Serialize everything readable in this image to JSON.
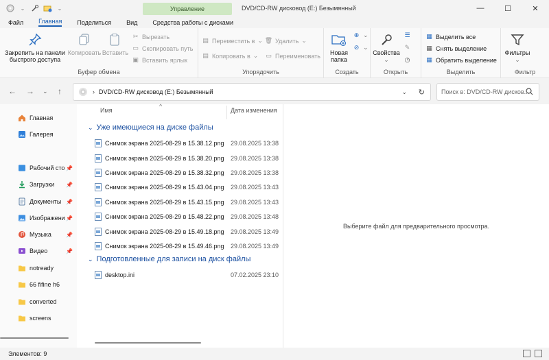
{
  "titlebar": {
    "context_tab": "Управление",
    "title": "DVD/CD-RW дисковод (E:) Безымянный"
  },
  "menu": [
    {
      "label": "Файл",
      "active": false
    },
    {
      "label": "Главная",
      "active": true
    },
    {
      "label": "Поделиться",
      "active": false
    },
    {
      "label": "Вид",
      "active": false
    },
    {
      "label": "Средства работы с дисками",
      "active": false
    }
  ],
  "ribbon": {
    "clipboard": {
      "pin_label": "Закрепить на панели быстрого доступа",
      "copy_label": "Копировать",
      "paste_label": "Вставить",
      "cut_label": "Вырезать",
      "copy_path_label": "Скопировать путь",
      "paste_shortcut_label": "Вставить ярлык",
      "group_label": "Буфер обмена"
    },
    "organize": {
      "move_label": "Переместить в",
      "copyto_label": "Копировать в",
      "delete_label": "Удалить",
      "rename_label": "Переименовать",
      "group_label": "Упорядочить"
    },
    "create": {
      "new_folder_label": "Новая папка",
      "group_label": "Создать"
    },
    "open": {
      "properties_label": "Свойства",
      "group_label": "Открыть"
    },
    "select": {
      "select_all_label": "Выделить все",
      "select_none_label": "Снять выделение",
      "invert_label": "Обратить выделение",
      "group_label": "Выделить"
    },
    "filter": {
      "filters_label": "Фильтры",
      "group_label": "Фильтр"
    }
  },
  "address": {
    "path": "DVD/CD-RW дисковод (E:) Безымянный",
    "search_placeholder": "Поиск в: DVD/CD-RW дисков..."
  },
  "sidebar": {
    "items": [
      {
        "label": "Главная",
        "icon": "home-icon",
        "pinned": false
      },
      {
        "label": "Галерея",
        "icon": "gallery-icon",
        "pinned": false
      },
      {
        "label": "Рабочий сто",
        "icon": "desktop-icon",
        "pinned": true
      },
      {
        "label": "Загрузки",
        "icon": "downloads-icon",
        "pinned": true
      },
      {
        "label": "Документы",
        "icon": "documents-icon",
        "pinned": true
      },
      {
        "label": "Изображени",
        "icon": "pictures-icon",
        "pinned": true
      },
      {
        "label": "Музыка",
        "icon": "music-icon",
        "pinned": true
      },
      {
        "label": "Видео",
        "icon": "video-icon",
        "pinned": true
      },
      {
        "label": "notready",
        "icon": "folder-icon",
        "pinned": false
      },
      {
        "label": "66 fifine h6",
        "icon": "folder-icon",
        "pinned": false
      },
      {
        "label": "converted",
        "icon": "folder-icon",
        "pinned": false
      },
      {
        "label": "screens",
        "icon": "folder-icon",
        "pinned": false
      }
    ]
  },
  "filelist": {
    "col_name": "Имя",
    "col_date": "Дата изменения",
    "groups": [
      {
        "title": "Уже имеющиеся на диске файлы",
        "files": [
          {
            "name": "Снимок экрана 2025-08-29 в 15.38.12.png",
            "date": "29.08.2025 13:38"
          },
          {
            "name": "Снимок экрана 2025-08-29 в 15.38.20.png",
            "date": "29.08.2025 13:38"
          },
          {
            "name": "Снимок экрана 2025-08-29 в 15.38.32.png",
            "date": "29.08.2025 13:38"
          },
          {
            "name": "Снимок экрана 2025-08-29 в 15.43.04.png",
            "date": "29.08.2025 13:43"
          },
          {
            "name": "Снимок экрана 2025-08-29 в 15.43.15.png",
            "date": "29.08.2025 13:43"
          },
          {
            "name": "Снимок экрана 2025-08-29 в 15.48.22.png",
            "date": "29.08.2025 13:48"
          },
          {
            "name": "Снимок экрана 2025-08-29 в 15.49.18.png",
            "date": "29.08.2025 13:49"
          },
          {
            "name": "Снимок экрана 2025-08-29 в 15.49.46.png",
            "date": "29.08.2025 13:49"
          }
        ]
      },
      {
        "title": "Подготовленные для записи на диск файлы",
        "files": [
          {
            "name": "desktop.ini",
            "date": "07.02.2025 23:10"
          }
        ]
      }
    ]
  },
  "preview": {
    "message": "Выберите файл для предварительного просмотра."
  },
  "status": {
    "items_count": "Элементов: 9"
  },
  "colors": {
    "accent": "#1a5fb4",
    "context_tab_bg": "#cfe8c3",
    "group_header": "#1a4fa0"
  }
}
